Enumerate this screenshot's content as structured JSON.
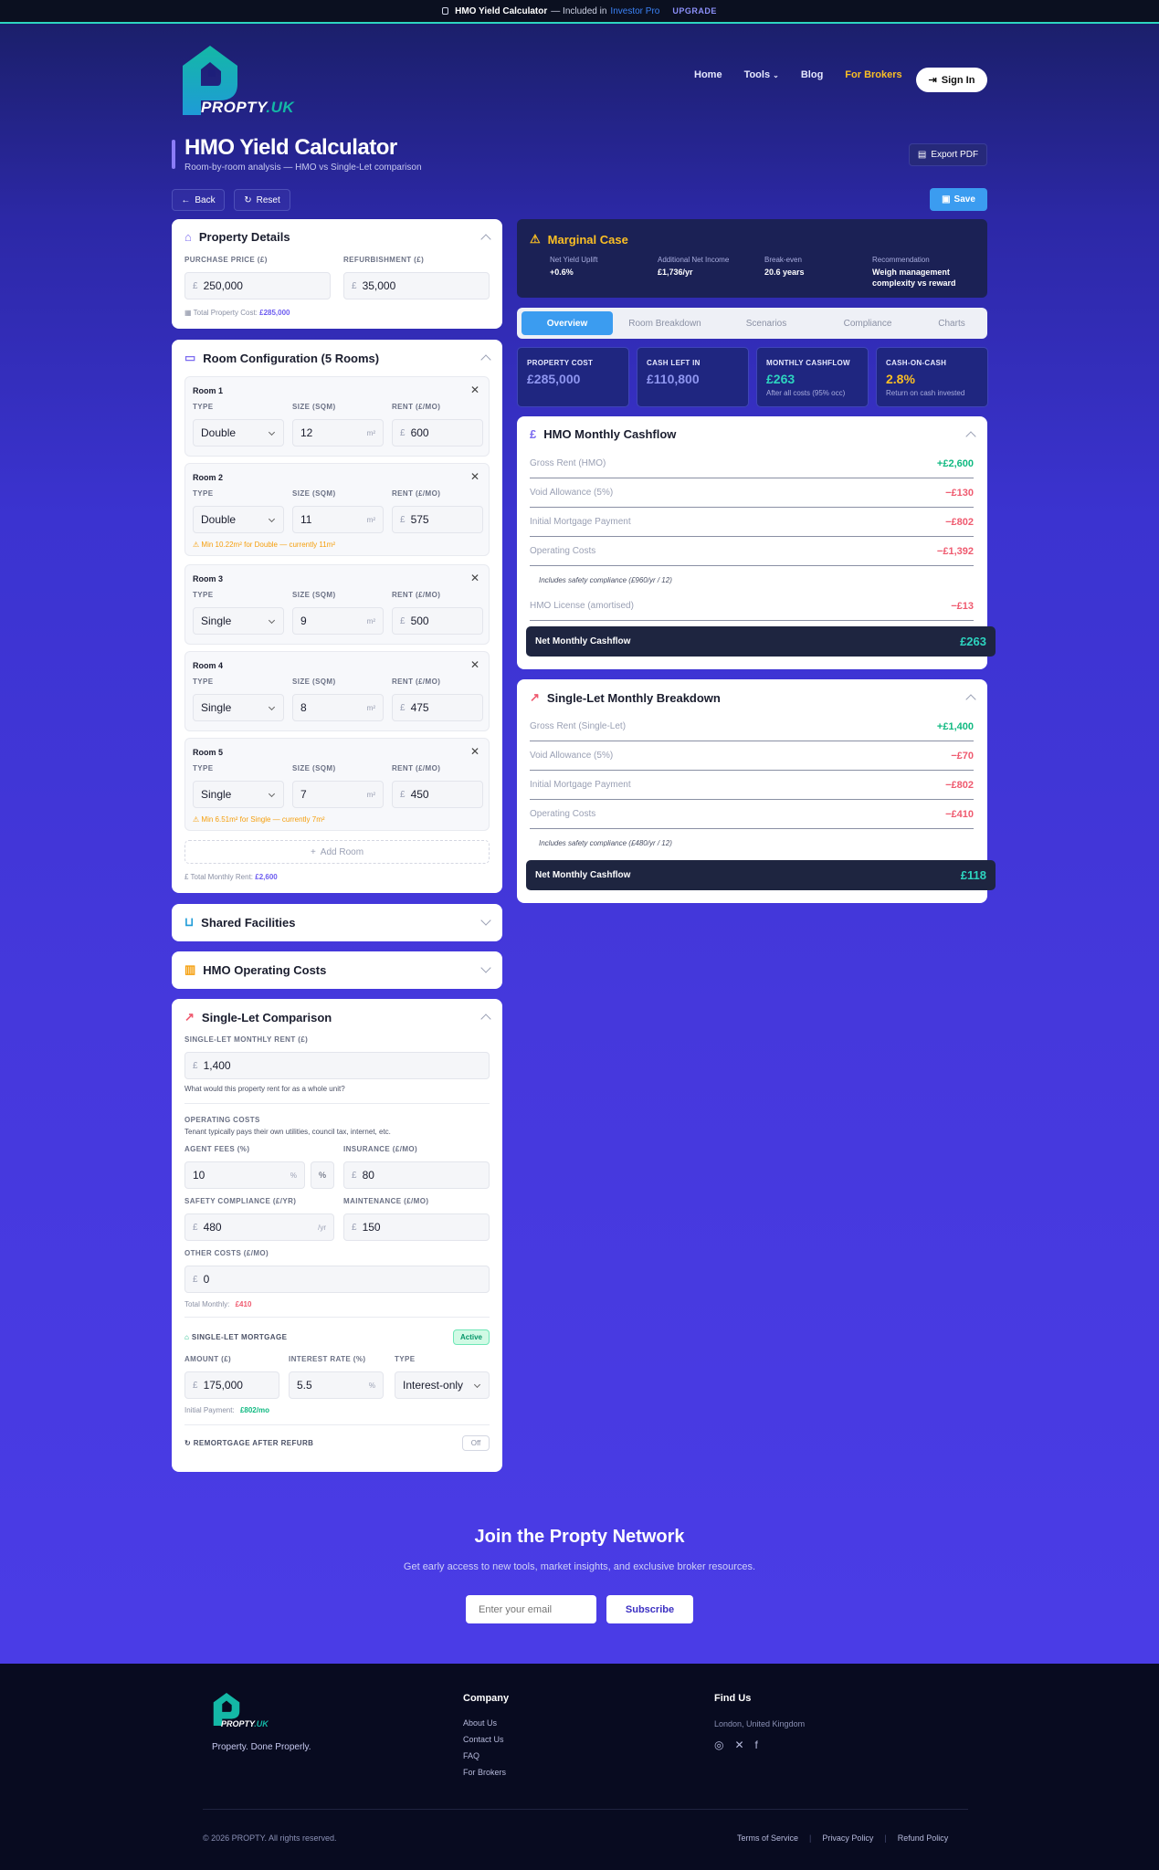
{
  "banner": {
    "title": "HMO Yield Calculator",
    "mid": "— Included in",
    "pro": "Investor Pro",
    "upgrade": "UPGRADE"
  },
  "brand": {
    "name": "PROPTY",
    "tld": ".UK",
    "accent": "#14b8a6"
  },
  "nav": {
    "home": "Home",
    "tools": "Tools",
    "blog": "Blog",
    "brokers": "For Brokers",
    "signin": "Sign In"
  },
  "page": {
    "title": "HMO Yield Calculator",
    "subtitle": "Room-by-room analysis — HMO vs Single-Let comparison",
    "export": "Export PDF",
    "back": "Back",
    "reset": "Reset",
    "save": "Save"
  },
  "property": {
    "title": "Property Details",
    "purchase_label": "PURCHASE PRICE (£)",
    "purchase": "250,000",
    "refurb_label": "REFURBISHMENT (£)",
    "refurb": "35,000",
    "total_label": "Total Property Cost:",
    "total": "£285,000"
  },
  "rooms": {
    "title": "Room Configuration (5 Rooms)",
    "type_label": "TYPE",
    "size_label": "SIZE (SQM)",
    "rent_label": "RENT (£/MO)",
    "unit": "m²",
    "add": "Add Room",
    "total_label": "Total Monthly Rent:",
    "total": "£2,600",
    "items": [
      {
        "name": "Room 1",
        "type": "Double",
        "size": "12",
        "rent": "600"
      },
      {
        "name": "Room 2",
        "type": "Double",
        "size": "11",
        "rent": "575",
        "warn": "Min 10.22m² for Double — currently 11m²"
      },
      {
        "name": "Room 3",
        "type": "Single",
        "size": "9",
        "rent": "500"
      },
      {
        "name": "Room 4",
        "type": "Single",
        "size": "8",
        "rent": "475"
      },
      {
        "name": "Room 5",
        "type": "Single",
        "size": "7",
        "rent": "450",
        "warn": "Min 6.51m² for Single — currently 7m²"
      }
    ]
  },
  "shared": {
    "title": "Shared Facilities"
  },
  "opcosts": {
    "title": "HMO Operating Costs"
  },
  "single": {
    "title": "Single-Let Comparison",
    "rent_label": "SINGLE-LET MONTHLY RENT (£)",
    "rent": "1,400",
    "rent_help": "What would this property rent for as a whole unit?",
    "oc_title": "OPERATING COSTS",
    "oc_help": "Tenant typically pays their own utilities, council tax, internet, etc.",
    "agent_label": "AGENT FEES (%)",
    "agent": "10",
    "pct": "%",
    "ins_label": "INSURANCE (£/MO)",
    "ins": "80",
    "safety_label": "SAFETY COMPLIANCE (£/YR)",
    "safety": "480",
    "yr": "/yr",
    "maint_label": "MAINTENANCE (£/MO)",
    "maint": "150",
    "other_label": "OTHER COSTS (£/MO)",
    "other": "0",
    "total_label": "Total Monthly:",
    "total": "£410",
    "mort_title": "SINGLE-LET MORTGAGE",
    "active": "Active",
    "amount_label": "AMOUNT (£)",
    "amount": "175,000",
    "rate_label": "INTEREST RATE (%)",
    "rate": "5.5",
    "mtype_label": "TYPE",
    "mtype": "Interest-only",
    "payment_label": "Initial Payment:",
    "payment": "£802/mo",
    "remort": "REMORTGAGE AFTER REFURB",
    "off": "Off"
  },
  "marginal": {
    "title": "Marginal Case",
    "items": [
      {
        "label": "Net Yield Uplift",
        "value": "+0.6%"
      },
      {
        "label": "Additional Net Income",
        "value": "£1,736/yr"
      },
      {
        "label": "Break-even",
        "value": "20.6 years"
      },
      {
        "label": "Recommendation",
        "value": "Weigh management complexity vs reward"
      }
    ]
  },
  "tabs": [
    "Overview",
    "Room Breakdown",
    "Scenarios",
    "Compliance",
    "Charts"
  ],
  "kpis": [
    {
      "label": "PROPERTY COST",
      "value": "£285,000",
      "sub": ""
    },
    {
      "label": "CASH LEFT IN",
      "value": "£110,800",
      "sub": ""
    },
    {
      "label": "MONTHLY CASHFLOW",
      "value": "£263",
      "sub": "After all costs (95% occ)"
    },
    {
      "label": "CASH-ON-CASH",
      "value": "2.8%",
      "sub": "Return on cash invested"
    }
  ],
  "hmo_cf": {
    "title": "HMO Monthly Cashflow",
    "rows": [
      {
        "label": "Gross Rent (HMO)",
        "value": "+£2,600"
      },
      {
        "label": "Void Allowance (5%)",
        "value": "−£130"
      },
      {
        "label": "Initial Mortgage Payment",
        "value": "−£802"
      },
      {
        "label": "Operating Costs",
        "value": "−£1,392"
      },
      {
        "label": "HMO License (amortised)",
        "value": "−£13"
      }
    ],
    "note": "Includes safety compliance (£960/yr / 12)",
    "net_label": "Net Monthly Cashflow",
    "net": "£263"
  },
  "sl_cf": {
    "title": "Single-Let Monthly Breakdown",
    "rows": [
      {
        "label": "Gross Rent (Single-Let)",
        "value": "+£1,400"
      },
      {
        "label": "Void Allowance (5%)",
        "value": "−£70"
      },
      {
        "label": "Initial Mortgage Payment",
        "value": "−£802"
      },
      {
        "label": "Operating Costs",
        "value": "−£410"
      }
    ],
    "note": "Includes safety compliance (£480/yr / 12)",
    "net_label": "Net Monthly Cashflow",
    "net": "£118"
  },
  "network": {
    "title": "Join the Propty Network",
    "sub": "Get early access to new tools, market insights, and exclusive broker resources.",
    "placeholder": "Enter your email",
    "button": "Subscribe"
  },
  "footer": {
    "tagline": "Property. Done Properly.",
    "company": "Company",
    "links": [
      "About Us",
      "Contact Us",
      "FAQ",
      "For Brokers"
    ],
    "find": "Find Us",
    "location": "London, United Kingdom",
    "copy": "© 2026 PROPTY. All rights reserved.",
    "terms": "Terms of Service",
    "privacy": "Privacy Policy",
    "refund": "Refund Policy"
  }
}
